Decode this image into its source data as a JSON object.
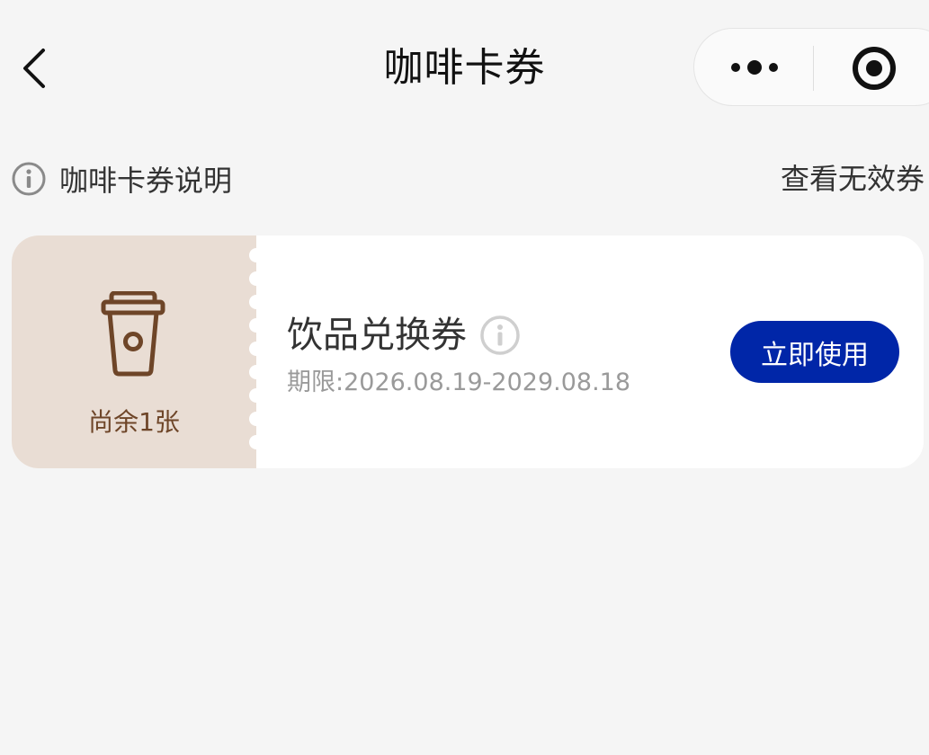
{
  "header": {
    "title": "咖啡卡券",
    "back_icon": "chevron-left-icon",
    "more_icon": "more-dots-icon",
    "close_icon": "record-target-icon"
  },
  "info_bar": {
    "explain_label": "咖啡卡券说明",
    "explain_icon": "info-circle-icon",
    "invalid_link": "查看无效券"
  },
  "coupons": [
    {
      "icon": "coffee-cup-icon",
      "remaining": "尚余1张",
      "name": "饮品兑换券",
      "validity": "期限:2026.08.19-2029.08.18",
      "action_label": "立即使用"
    }
  ],
  "colors": {
    "background": "#f5f5f5",
    "ticket_stub": "#e9ddd4",
    "stub_text": "#6e4528",
    "primary_button": "#0026a8"
  }
}
